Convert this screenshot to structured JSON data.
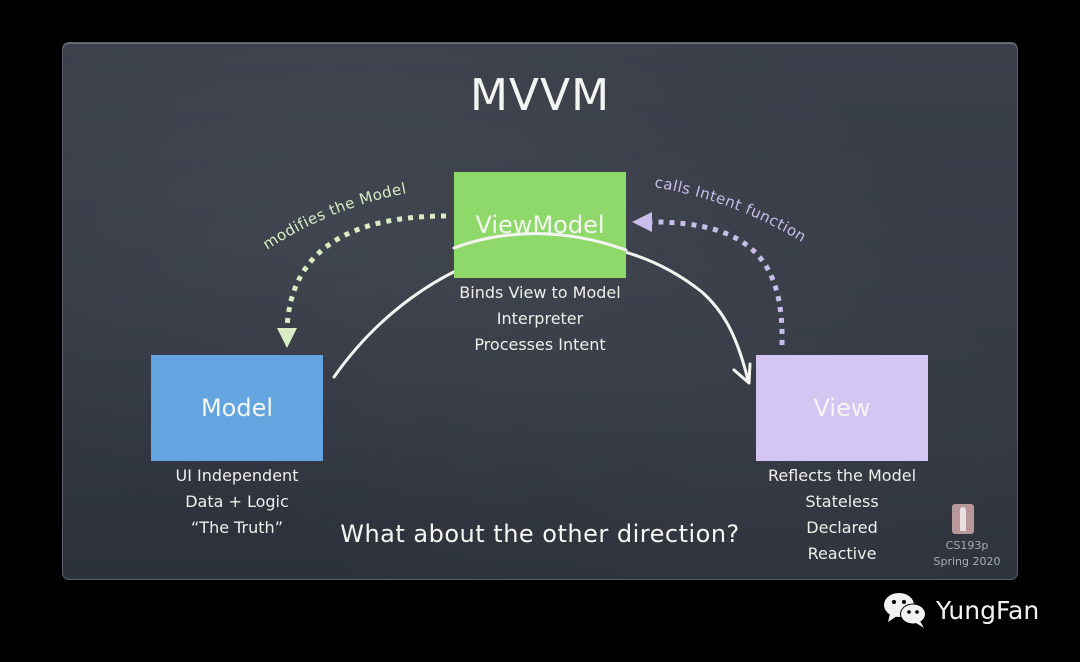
{
  "slide": {
    "title": "MVVM",
    "boxes": {
      "viewmodel": {
        "label": "ViewModel",
        "color": "#8fd86a"
      },
      "model": {
        "label": "Model",
        "color": "#64a4e0"
      },
      "view": {
        "label": "View",
        "color": "#d3c6f2"
      }
    },
    "captions": {
      "viewmodel": [
        "Binds View to Model",
        "Interpreter",
        "Processes Intent"
      ],
      "model": [
        "UI Independent",
        "Data + Logic",
        "“The Truth”"
      ],
      "view": [
        "Reflects the Model",
        "Stateless",
        "Declared",
        "Reactive"
      ]
    },
    "arrows": {
      "vm_to_model": {
        "label": "modifies the Model",
        "color": "#d9ecc4",
        "style": "dotted"
      },
      "view_to_vm": {
        "label": "calls Intent function",
        "color": "#c9bdea",
        "style": "dotted"
      },
      "model_to_view": {
        "label": "",
        "color": "#f4f4f2",
        "style": "solid"
      }
    },
    "question": "What about the other direction?",
    "course": {
      "logo_icon": "stanford-s-logo",
      "name": "CS193p",
      "term": "Spring 2020"
    }
  },
  "watermark": {
    "icon": "wechat-icon",
    "text": "YungFan"
  }
}
